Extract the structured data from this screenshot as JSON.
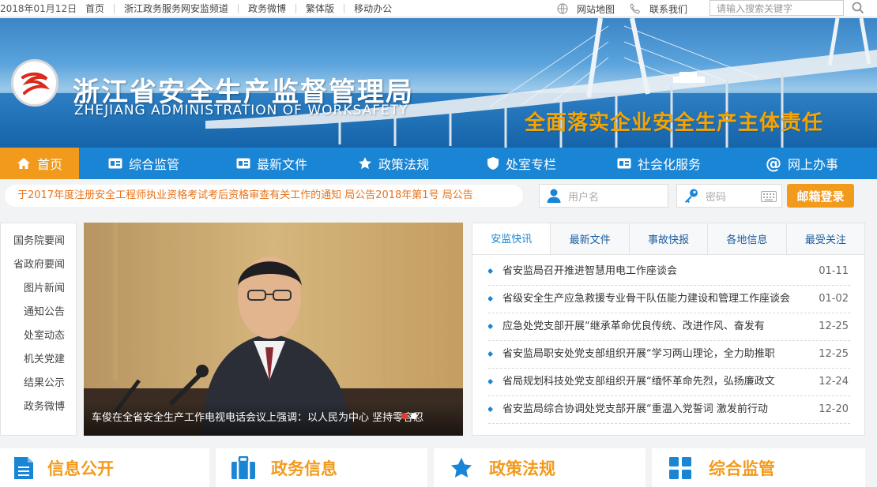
{
  "topbar": {
    "date": "2018年01月12日",
    "links": [
      "首页",
      "浙江政务服务网安监频道",
      "政务微博",
      "繁体版",
      "移动办公"
    ],
    "sitemap": "网站地图",
    "contact": "联系我们",
    "search_placeholder": "请输入搜索关键字"
  },
  "banner": {
    "title_cn": "浙江省安全生产监督管理局",
    "title_en": "ZHEJIANG ADMINISTRATION OF WORKSAFETY",
    "slogan": "全面落实企业安全生产主体责任"
  },
  "nav": [
    {
      "label": "首页",
      "icon": "home-icon"
    },
    {
      "label": "综合监管",
      "icon": "card-icon"
    },
    {
      "label": "最新文件",
      "icon": "card-icon"
    },
    {
      "label": "政策法规",
      "icon": "star-icon"
    },
    {
      "label": "处室专栏",
      "icon": "shield-icon"
    },
    {
      "label": "社会化服务",
      "icon": "card-icon"
    },
    {
      "label": "网上办事",
      "icon": "at-icon"
    }
  ],
  "strip": {
    "marquee": "于2017年度注册安全工程师执业资格考试考后资格审查有关工作的通知   局公告2018年第1号   局公告",
    "username_placeholder": "用户名",
    "password_placeholder": "密码",
    "login_label": "邮箱登录"
  },
  "sidebar": [
    "国务院要闻",
    "省政府要闻",
    "图片新闻",
    "通知公告",
    "处室动态",
    "机关党建",
    "结果公示",
    "政务微博"
  ],
  "photo": {
    "caption": "车俊在全省安全生产工作电视电话会议上强调：以人民为中心 坚持零容忍"
  },
  "news": {
    "tabs": [
      "安监快讯",
      "最新文件",
      "事故快报",
      "各地信息",
      "最受关注"
    ],
    "items": [
      {
        "title": "省安监局召开推进智慧用电工作座谈会",
        "date": "01-11"
      },
      {
        "title": "省级安全生产应急救援专业骨干队伍能力建设和管理工作座谈会",
        "date": "01-02"
      },
      {
        "title": "应急处党支部开展“继承革命优良传统、改进作风、奋发有",
        "date": "12-25"
      },
      {
        "title": "省安监局职安处党支部组织开展“学习两山理论，全力助推职",
        "date": "12-25"
      },
      {
        "title": "省局规划科技处党支部组织开展“缅怀革命先烈，弘扬廉政文",
        "date": "12-24"
      },
      {
        "title": "省安监局综合协调处党支部开展“重温入党誓词 激发前行动",
        "date": "12-20"
      }
    ]
  },
  "tiles": [
    {
      "label": "信息公开",
      "icon": "document-icon"
    },
    {
      "label": "政务信息",
      "icon": "briefcase-icon"
    },
    {
      "label": "政策法规",
      "icon": "star-icon"
    },
    {
      "label": "综合监管",
      "icon": "grid-icon"
    }
  ],
  "colors": {
    "nav_blue": "#1a85d4",
    "accent_orange": "#f29a1b",
    "link_blue": "#1a5d9e"
  }
}
